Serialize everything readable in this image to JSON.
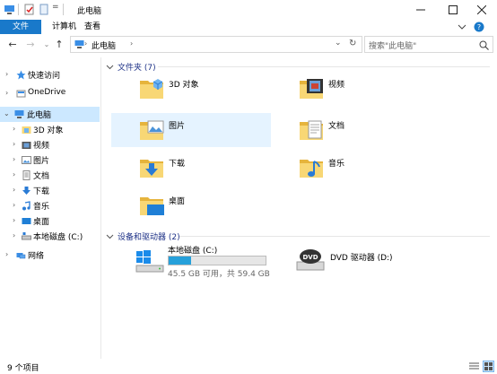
{
  "window": {
    "title": "此电脑",
    "min_icon": "minimize-icon",
    "max_icon": "maximize-icon",
    "close_icon": "close-icon"
  },
  "ribbon": {
    "tabs": [
      "文件",
      "计算机",
      "查看"
    ],
    "active_color": "#1979ca"
  },
  "address": {
    "path": "此电脑",
    "search_placeholder": "搜索\"此电脑\""
  },
  "sidebar": {
    "items": [
      {
        "label": "快速访问",
        "icon": "star-icon"
      },
      {
        "label": "OneDrive",
        "icon": "cloud-icon"
      },
      {
        "label": "此电脑",
        "icon": "pc-icon"
      },
      {
        "label": "3D 对象",
        "icon": "3d-objects-icon"
      },
      {
        "label": "视频",
        "icon": "video-icon"
      },
      {
        "label": "图片",
        "icon": "picture-icon"
      },
      {
        "label": "文档",
        "icon": "document-icon"
      },
      {
        "label": "下载",
        "icon": "download-icon"
      },
      {
        "label": "音乐",
        "icon": "music-icon"
      },
      {
        "label": "桌面",
        "icon": "desktop-icon"
      },
      {
        "label": "本地磁盘 (C:)",
        "icon": "drive-icon"
      },
      {
        "label": "网络",
        "icon": "network-icon"
      }
    ],
    "selected_color": "#cce8ff"
  },
  "folders": {
    "header": "文件夹 (7)",
    "items": [
      {
        "label": "3D 对象",
        "icon": "3d-objects-folder-icon"
      },
      {
        "label": "视频",
        "icon": "video-folder-icon"
      },
      {
        "label": "图片",
        "icon": "picture-folder-icon"
      },
      {
        "label": "文档",
        "icon": "document-folder-icon"
      },
      {
        "label": "下载",
        "icon": "download-folder-icon"
      },
      {
        "label": "音乐",
        "icon": "music-folder-icon"
      },
      {
        "label": "桌面",
        "icon": "desktop-folder-icon"
      }
    ]
  },
  "devices": {
    "header": "设备和驱动器 (2)",
    "items": [
      {
        "label": "本地磁盘 (C:)",
        "space": "45.5 GB 可用，共 59.4 GB",
        "used_fraction": 0.234,
        "icon": "windows-drive-icon"
      },
      {
        "label": "DVD 驱动器 (D:)",
        "icon": "dvd-drive-icon"
      }
    ],
    "bar_color": "#26a0da"
  },
  "status": {
    "count": "9 个项目"
  },
  "colors": {
    "folder": "#f8d775",
    "folder_dark": "#e6b43c",
    "accent": "#1979ca",
    "header_text": "#1e3287"
  }
}
